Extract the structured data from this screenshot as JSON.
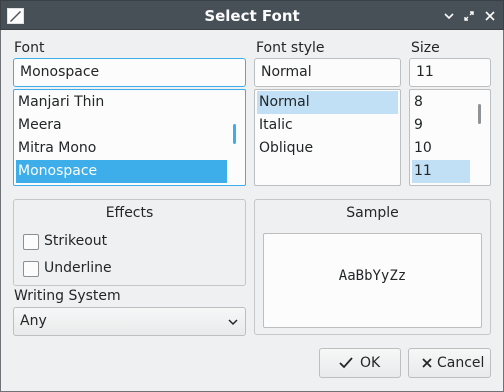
{
  "window": {
    "title": "Select Font",
    "titlebar_color": "#475057",
    "controls": [
      "chevron-down-icon",
      "restore-icon",
      "close-icon"
    ]
  },
  "font": {
    "label": "Font",
    "value": "Monospace",
    "items": [
      "Manjari Thin",
      "Meera",
      "Mitra Mono",
      "Monospace"
    ],
    "selected": "Monospace"
  },
  "style": {
    "label": "Font style",
    "value": "Normal",
    "items": [
      "Normal",
      "Italic",
      "Oblique"
    ],
    "selected": "Normal"
  },
  "size": {
    "label": "Size",
    "value": "11",
    "items": [
      "8",
      "9",
      "10",
      "11"
    ],
    "selected": "11"
  },
  "effects": {
    "title": "Effects",
    "strikeout_label": "Strikeout",
    "strikeout_checked": false,
    "underline_label": "Underline",
    "underline_checked": false
  },
  "sample": {
    "title": "Sample",
    "text": "AaBbYyZz"
  },
  "writing_system": {
    "label": "Writing System",
    "value": "Any"
  },
  "buttons": {
    "ok_label": "OK",
    "cancel_label": "Cancel"
  },
  "colors": {
    "accent": "#3daee9",
    "window_bg": "#eff0f1"
  }
}
